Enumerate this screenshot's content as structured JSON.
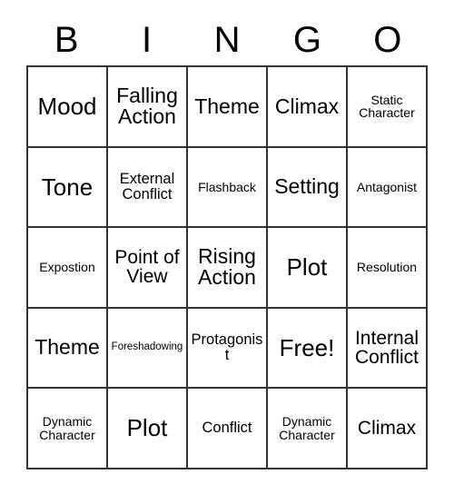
{
  "card": {
    "header_letters": [
      "B",
      "I",
      "N",
      "G",
      "O"
    ],
    "rows": [
      [
        {
          "text": "Mood",
          "size": "xxl"
        },
        {
          "text": "Falling Action",
          "size": "xl"
        },
        {
          "text": "Theme",
          "size": "xl"
        },
        {
          "text": "Climax",
          "size": "xl"
        },
        {
          "text": "Static Character",
          "size": "sm"
        }
      ],
      [
        {
          "text": "Tone",
          "size": "xxl"
        },
        {
          "text": "External Conflict",
          "size": "md"
        },
        {
          "text": "Flashback",
          "size": "sm"
        },
        {
          "text": "Setting",
          "size": "xl"
        },
        {
          "text": "Antagonist",
          "size": "sm"
        }
      ],
      [
        {
          "text": "Expostion",
          "size": "sm"
        },
        {
          "text": "Point of View",
          "size": "lg"
        },
        {
          "text": "Rising Action",
          "size": "xl"
        },
        {
          "text": "Plot",
          "size": "xxl"
        },
        {
          "text": "Resolution",
          "size": "sm"
        }
      ],
      [
        {
          "text": "Theme",
          "size": "xl"
        },
        {
          "text": "Foreshadowing",
          "size": "xs"
        },
        {
          "text": "Protagonist",
          "size": "md"
        },
        {
          "text": "Free!",
          "size": "xxl"
        },
        {
          "text": "Internal Conflict",
          "size": "lg"
        }
      ],
      [
        {
          "text": "Dynamic Character",
          "size": "sm"
        },
        {
          "text": "Plot",
          "size": "xxl"
        },
        {
          "text": "Conflict",
          "size": "md"
        },
        {
          "text": "Dynamic Character",
          "size": "sm"
        },
        {
          "text": "Climax",
          "size": "lg"
        }
      ]
    ]
  }
}
